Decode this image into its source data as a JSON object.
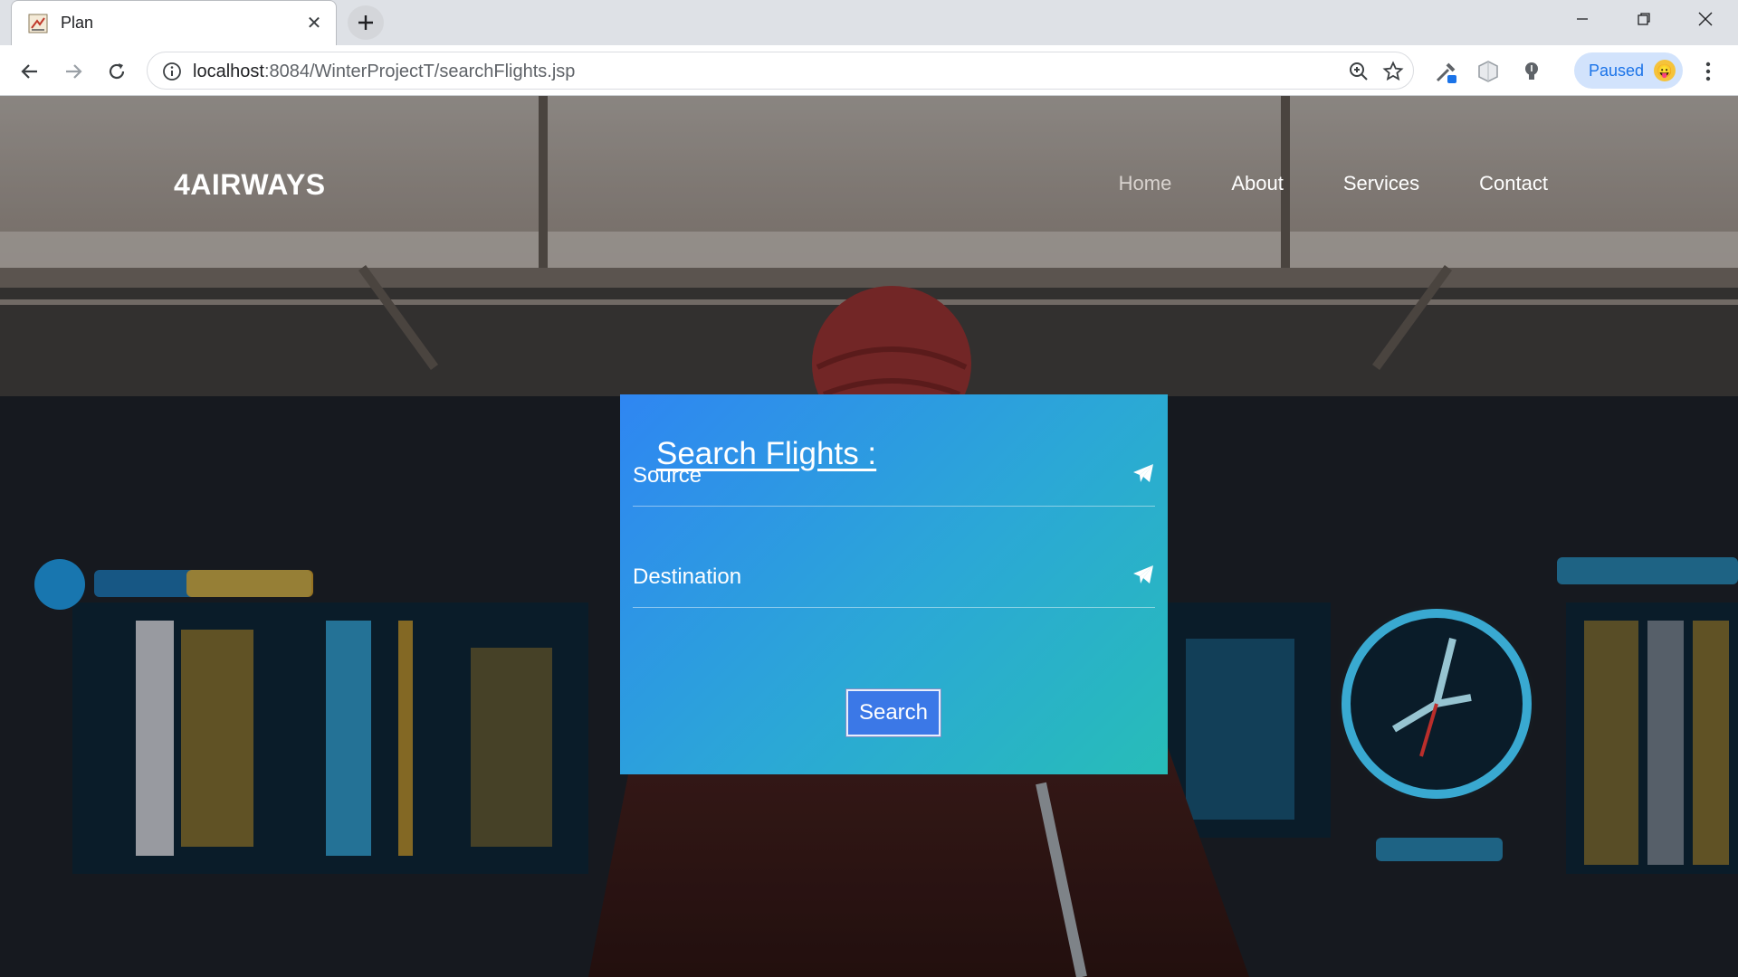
{
  "browser": {
    "tab_title": "Plan",
    "url_host": "localhost",
    "url_path": ":8084/WinterProjectT/searchFlights.jsp",
    "profile_label": "Paused"
  },
  "site": {
    "brand": "4AIRWAYS",
    "nav": [
      "Home",
      "About",
      "Services",
      "Contact"
    ],
    "active_nav": "Home"
  },
  "search": {
    "title": "Search Flights :",
    "source_label": "Source",
    "destination_label": "Destination",
    "button_label": "Search"
  },
  "colors": {
    "card_gradient_start": "#2f86f2",
    "card_gradient_end": "#27bdb8",
    "button": "#3b78e7"
  }
}
